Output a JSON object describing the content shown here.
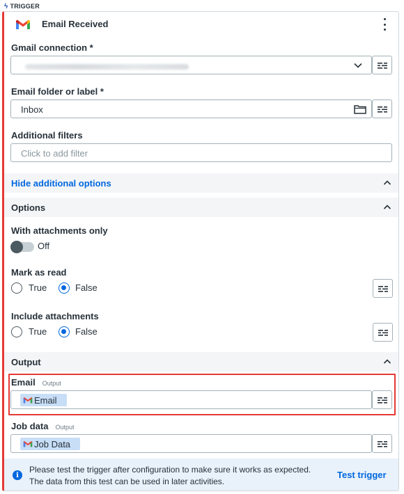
{
  "trigger_tag": "TRIGGER",
  "header": {
    "title": "Email Received",
    "icon": "gmail-logo-icon"
  },
  "gmail_connection": {
    "label": "Gmail connection *",
    "value": ""
  },
  "email_folder": {
    "label": "Email folder or label *",
    "value": "Inbox"
  },
  "additional_filters": {
    "label": "Additional filters",
    "placeholder": "Click to add filter"
  },
  "hide_options_link": "Hide additional options",
  "options_section": {
    "title": "Options"
  },
  "with_attachments": {
    "label": "With attachments only",
    "state": "Off"
  },
  "mark_as_read": {
    "label": "Mark as read",
    "options": [
      "True",
      "False"
    ],
    "selected": "False"
  },
  "include_attachments": {
    "label": "Include attachments",
    "options": [
      "True",
      "False"
    ],
    "selected": "False"
  },
  "output_section": {
    "title": "Output"
  },
  "email_output": {
    "label": "Email",
    "tag": "Output",
    "chip": "Email"
  },
  "job_data_output": {
    "label": "Job data",
    "tag": "Output",
    "chip": "Job Data"
  },
  "info": {
    "text": "Please test the trigger after configuration to make sure it works as expected. The data from this test can be used in later activities.",
    "action": "Test trigger"
  },
  "colors": {
    "accent": "#0067df",
    "error_border": "#e53935",
    "chip_bg": "#c8def7",
    "info_bg": "#e9f1fa"
  }
}
